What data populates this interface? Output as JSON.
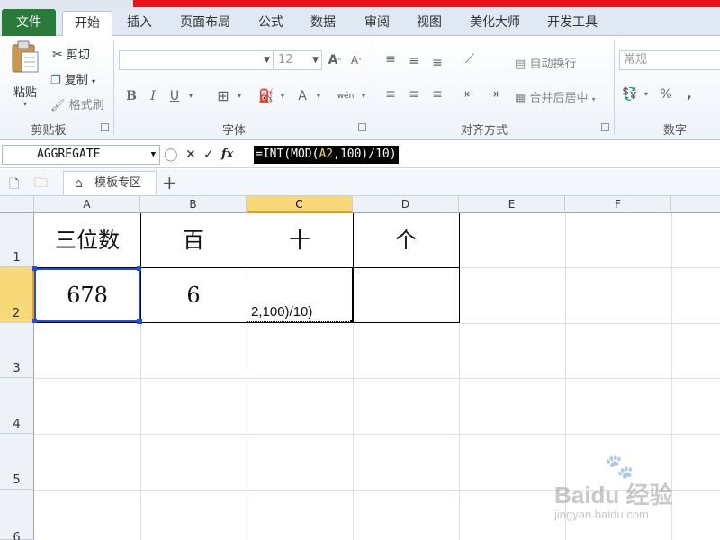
{
  "tabs": [
    "文件",
    "开始",
    "插入",
    "页面布局",
    "公式",
    "数据",
    "审阅",
    "视图",
    "美化大师",
    "开发工具"
  ],
  "clipboard": {
    "paste": "粘贴",
    "cut": "剪切",
    "copy": "复制",
    "format_painter": "格式刷",
    "label": "剪贴板"
  },
  "font": {
    "size": "12",
    "bold": "B",
    "italic": "I",
    "underline": "U",
    "font_color": "A",
    "phonetic": "wén",
    "label": "字体"
  },
  "alignment": {
    "wrap_text": "自动换行",
    "merge_center": "合并后居中",
    "label": "对齐方式"
  },
  "number": {
    "format": "常规",
    "percent": "%",
    "comma": ",",
    "label": "数字"
  },
  "formula_bar": {
    "name_box": "AGGREGATE",
    "cancel": "✕",
    "enter": "✓",
    "fx": "fx",
    "formula_prefix": "=INT(MOD(",
    "formula_ref": "A2",
    "formula_suffix": ",100)/10)"
  },
  "doc_tab": {
    "title": "模板专区",
    "add": "+"
  },
  "sheet": {
    "columns": [
      "A",
      "B",
      "C",
      "D",
      "E",
      "F"
    ],
    "rows": [
      "1",
      "2",
      "3",
      "4",
      "5",
      "6"
    ],
    "cells": {
      "A1": "三位数",
      "B1": "百",
      "C1": "十",
      "D1": "个",
      "A2": "678",
      "B2": "6",
      "C2": "2,100)/10)"
    }
  },
  "watermark": {
    "brand": "Baidu 经验",
    "url": "jingyan.baidu.com"
  },
  "colors": {
    "file_tab": "#2a7a3a",
    "selection_header": "#f8d97a",
    "selection_border": "#1f4fd6",
    "formula_ref": "#f0e030"
  }
}
